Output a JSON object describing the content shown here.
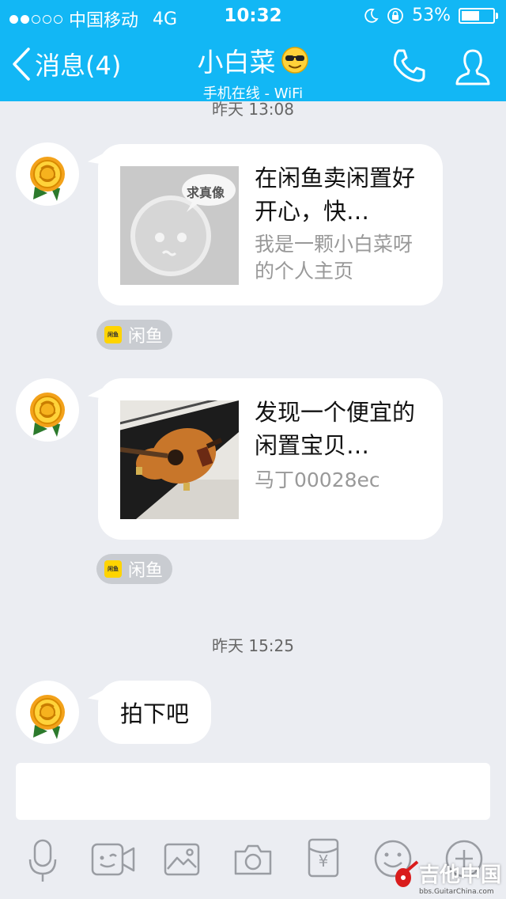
{
  "status_bar": {
    "carrier": "中国移动",
    "network": "4G",
    "time": "10:32",
    "battery": "53%"
  },
  "nav": {
    "back_label": "消息(4)",
    "title": "小白菜",
    "subtitle": "手机在线 - WiFi",
    "accent": "#12b7f5"
  },
  "messages": [
    {
      "timestamp": "昨天 13:08"
    },
    {
      "card_title": "在闲鱼卖闲置好开心，快…",
      "card_desc": "我是一颗小白菜呀的个人主页",
      "thumb_text": "求真像",
      "source": "闲鱼"
    },
    {
      "card_title": "发现一个便宜的闲置宝贝…",
      "card_desc": "马丁00028ec",
      "source": "闲鱼"
    },
    {
      "timestamp": "昨天 15:25"
    },
    {
      "text": "拍下吧"
    }
  ],
  "source_logo_text": "闲鱼",
  "toolbar": {
    "icons": [
      "microphone-icon",
      "video-icon",
      "image-icon",
      "camera-icon",
      "red-packet-icon",
      "emoji-icon",
      "plus-icon"
    ],
    "red_packet_symbol": "¥"
  },
  "watermark": {
    "main": "吉他中国",
    "sub": "bbs.GuitarChina.com"
  }
}
